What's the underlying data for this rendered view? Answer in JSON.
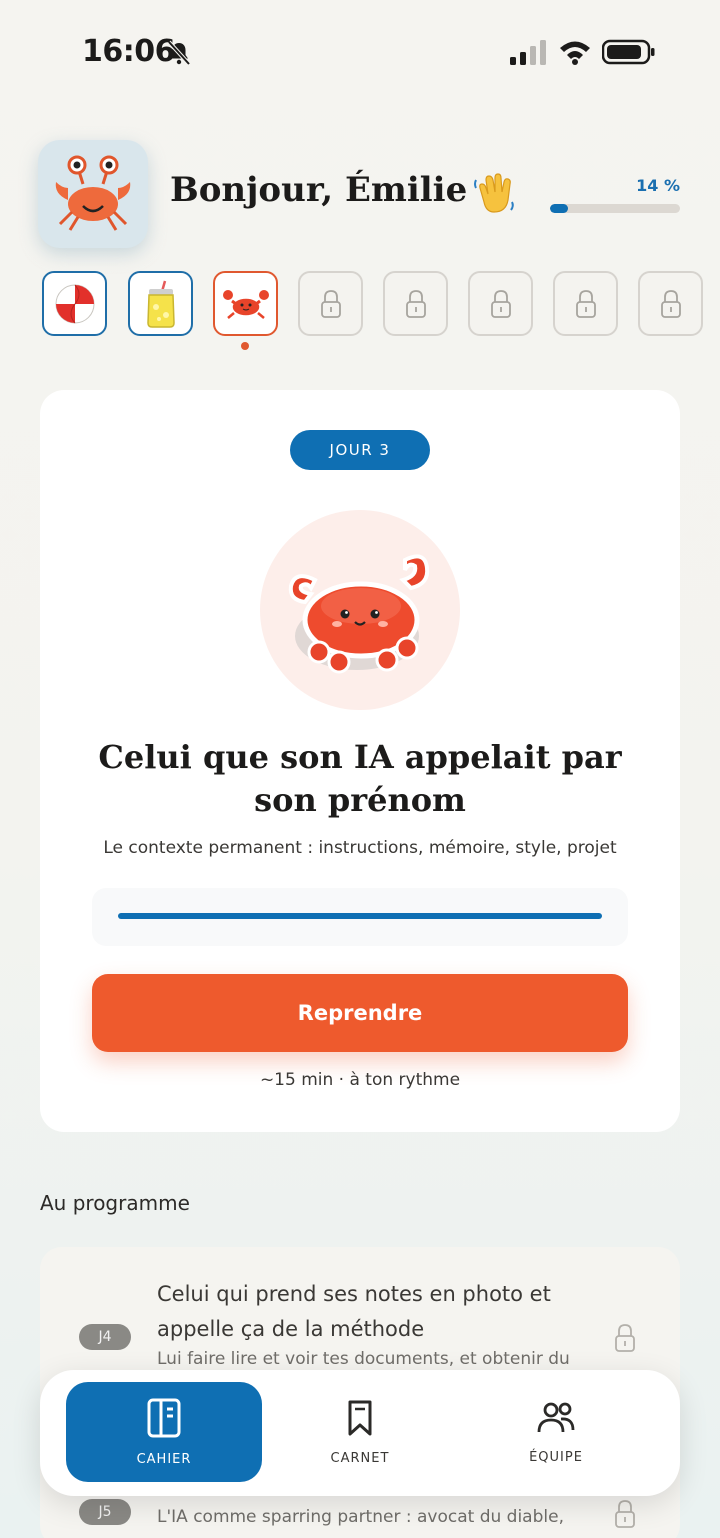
{
  "status_bar": {
    "time": "16:06"
  },
  "header": {
    "greeting": "Bonjour, Émilie",
    "progress_label": "14 %",
    "progress_fraction": 0.14
  },
  "days": {
    "icons": [
      "beach-ball-icon",
      "lemonade-jar-icon",
      "crab-icon",
      "lock-icon",
      "lock-icon",
      "lock-icon",
      "lock-icon",
      "lock-icon"
    ]
  },
  "lesson": {
    "day_label": "JOUR 3",
    "title": "Celui que son IA appelait par son prénom",
    "subtitle": "Le contexte permanent : instructions, mémoire, style, projet",
    "progress_fraction": 1.0,
    "resume_label": "Reprendre",
    "duration": "~15 min · à ton rythme"
  },
  "program": {
    "section_title": "Au programme",
    "items": [
      {
        "badge": "J4",
        "title": "Celui qui prend ses notes en photo et appelle ça de la méthode",
        "desc": "Lui faire lire et voir tes documents, et obtenir du"
      },
      {
        "badge": "J5",
        "title": "",
        "desc": "L'IA comme sparring partner : avocat du diable,"
      }
    ]
  },
  "tabs": [
    {
      "label": "CAHIER",
      "icon": "notebook-icon",
      "active": true
    },
    {
      "label": "CARNET",
      "icon": "bookmark-icon",
      "active": false
    },
    {
      "label": "ÉQUIPE",
      "icon": "team-icon",
      "active": false
    }
  ],
  "colors": {
    "accent_blue": "#0f6fb3",
    "accent_orange": "#ee5a2d",
    "background": "#f5f4f0"
  }
}
